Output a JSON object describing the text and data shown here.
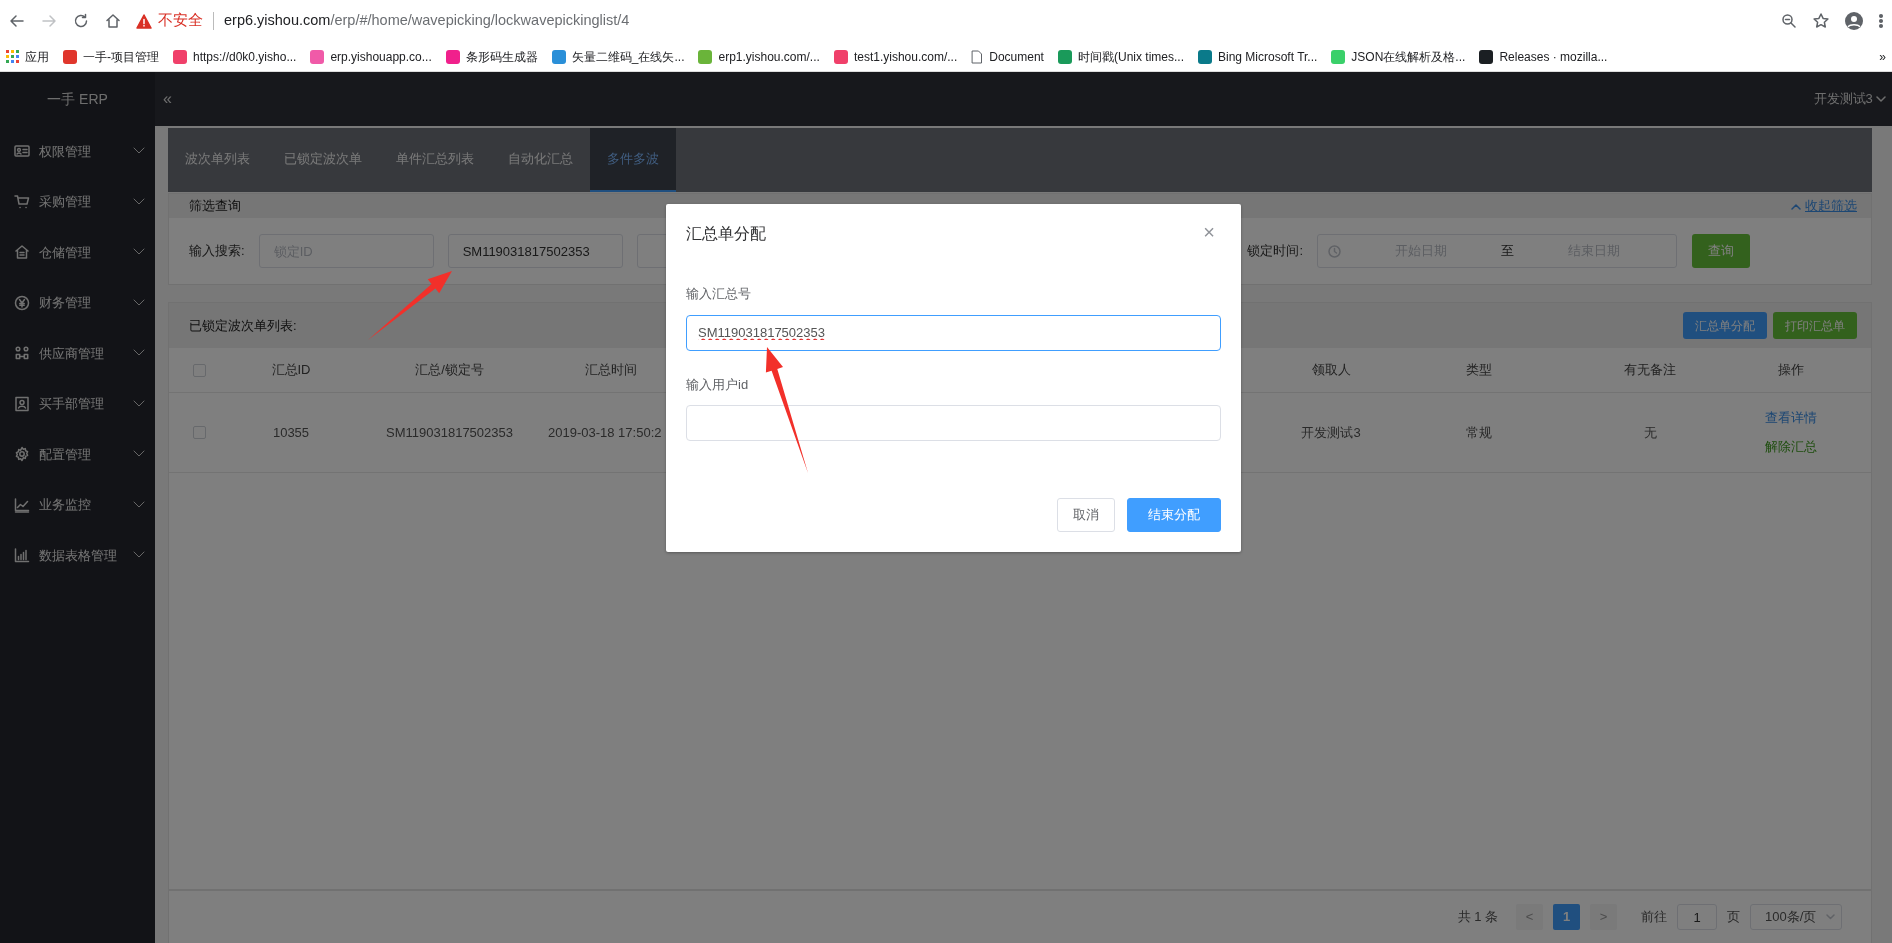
{
  "browser": {
    "warning": "不安全",
    "url_host": "erp6.yishou.com",
    "url_path": "/erp/#/home/wavepicking/lockwavepickinglist/4",
    "bookmarks": [
      {
        "label": "应用",
        "kind": "apps"
      },
      {
        "label": "一手-项目管理",
        "kind": "site",
        "color": "#e0362c"
      },
      {
        "label": "https://d0k0.yisho...",
        "kind": "site",
        "color": "#f0406a"
      },
      {
        "label": "erp.yishouapp.co...",
        "kind": "site",
        "color": "#f05aa8"
      },
      {
        "label": "条形码生成器",
        "kind": "site",
        "color": "#f0208c"
      },
      {
        "label": "矢量二维码_在线矢...",
        "kind": "site",
        "color": "#2a8fd8"
      },
      {
        "label": "erp1.yishou.com/...",
        "kind": "site",
        "color": "#6ab43a"
      },
      {
        "label": "test1.yishou.com/...",
        "kind": "site",
        "color": "#f0406a"
      },
      {
        "label": "Document",
        "kind": "page"
      },
      {
        "label": "时间戳(Unix times...",
        "kind": "site",
        "color": "#1a9a5a"
      },
      {
        "label": "Bing Microsoft Tr...",
        "kind": "site",
        "color": "#0a7a8a"
      },
      {
        "label": "JSON在线解析及格...",
        "kind": "site",
        "color": "#3ad06a"
      },
      {
        "label": "Releases · mozilla...",
        "kind": "site",
        "color": "#1b1f23"
      }
    ],
    "more": "»"
  },
  "app": {
    "logo": "一手 ERP",
    "collapse": "«",
    "user": "开发测试3"
  },
  "sidebar": {
    "items": [
      {
        "label": "权限管理",
        "expanded": false
      },
      {
        "label": "采购管理",
        "expanded": false
      },
      {
        "label": "仓储管理",
        "expanded": false
      },
      {
        "label": "财务管理",
        "expanded": false
      },
      {
        "label": "供应商管理",
        "expanded": false
      },
      {
        "label": "买手部管理",
        "expanded": false
      },
      {
        "label": "配置管理",
        "expanded": false
      },
      {
        "label": "业务监控",
        "expanded": false
      },
      {
        "label": "数据表格管理",
        "expanded": false
      }
    ]
  },
  "tabs": [
    {
      "label": "波次单列表",
      "selected": false
    },
    {
      "label": "已锁定波次单",
      "selected": false
    },
    {
      "label": "单件汇总列表",
      "selected": false
    },
    {
      "label": "自动化汇总",
      "selected": false
    },
    {
      "label": "多件多波",
      "selected": true
    }
  ],
  "filter": {
    "title": "筛选查询",
    "collapse": "收起筛选",
    "search_label": "输入搜索:",
    "fields": [
      {
        "placeholder": "锁定ID"
      },
      {
        "value": "SM119031817502353"
      }
    ],
    "time_label": "锁定时间:",
    "start_placeholder": "开始日期",
    "range_separator": "至",
    "end_placeholder": "结束日期",
    "query_button": "查询"
  },
  "table": {
    "title": "已锁定波次单列表:",
    "buttons": [
      {
        "label": "汇总单分配",
        "kind": "primary"
      },
      {
        "label": "打印汇总单",
        "kind": "success"
      }
    ],
    "header_checked": false,
    "columns": [
      "汇总ID",
      "汇总/锁定号",
      "汇总时间",
      "领取人",
      "类型",
      "有无备注",
      "操作"
    ],
    "rows": [
      {
        "checked": false,
        "cells": [
          "10355",
          "SM119031817502353",
          "2019-03-18 17:50:2",
          "开发测试3",
          "常规",
          "无"
        ],
        "actions": [
          {
            "label": "查看详情",
            "kind": "primary"
          },
          {
            "label": "解除汇总",
            "kind": "success"
          }
        ]
      }
    ]
  },
  "pagination": {
    "total": "共 1 条",
    "prev": "<",
    "pages": [
      {
        "label": "1",
        "selected": true
      }
    ],
    "next": ">",
    "goto_label": "前往",
    "goto_value": "1",
    "page_label": "页",
    "page_size": "100条/页"
  },
  "modal": {
    "title": "汇总单分配",
    "close": "×",
    "fields": [
      {
        "label": "输入汇总号",
        "value": "SM119031817502353",
        "focused": true,
        "misspelled": true
      },
      {
        "label": "输入用户id",
        "focused": false
      }
    ],
    "buttons": [
      {
        "label": "取消",
        "kind": "default"
      },
      {
        "label": "结束分配",
        "kind": "primary"
      }
    ]
  }
}
